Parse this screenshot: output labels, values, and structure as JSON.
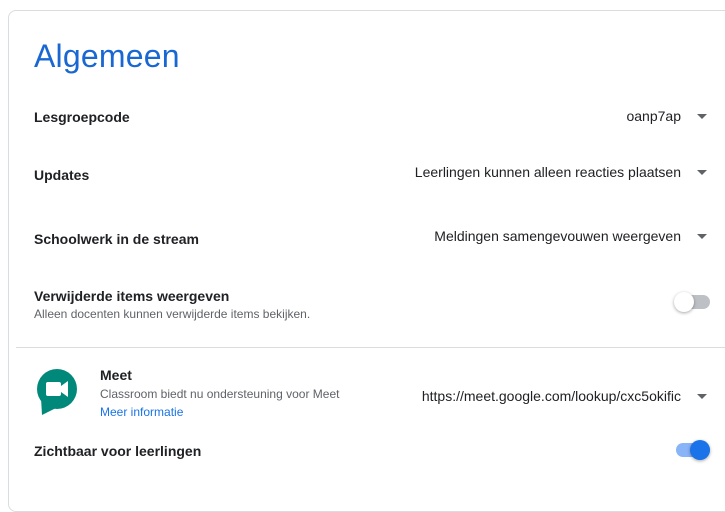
{
  "section": {
    "title": "Algemeen"
  },
  "settings": {
    "class_code": {
      "label": "Lesgroepcode",
      "value": "oanp7ap"
    },
    "updates": {
      "label": "Updates",
      "value": "Leerlingen kunnen alleen reacties plaatsen"
    },
    "classwork_stream": {
      "label": "Schoolwerk in de stream",
      "value": "Meldingen samengevouwen weergeven"
    },
    "deleted_items": {
      "label": "Verwijderde items weergeven",
      "description": "Alleen docenten kunnen verwijderde items bekijken.",
      "enabled": false
    }
  },
  "meet": {
    "title": "Meet",
    "description": "Classroom biedt nu ondersteuning voor Meet",
    "more_info": "Meer informatie",
    "link_value": "https://meet.google.com/lookup/cxc5okific",
    "icon": "google-meet-icon",
    "visible_to_students": {
      "label": "Zichtbaar voor leerlingen",
      "enabled": true
    }
  },
  "colors": {
    "accent": "#1a73e8",
    "title": "#1967d2",
    "divider": "#dadce0"
  }
}
